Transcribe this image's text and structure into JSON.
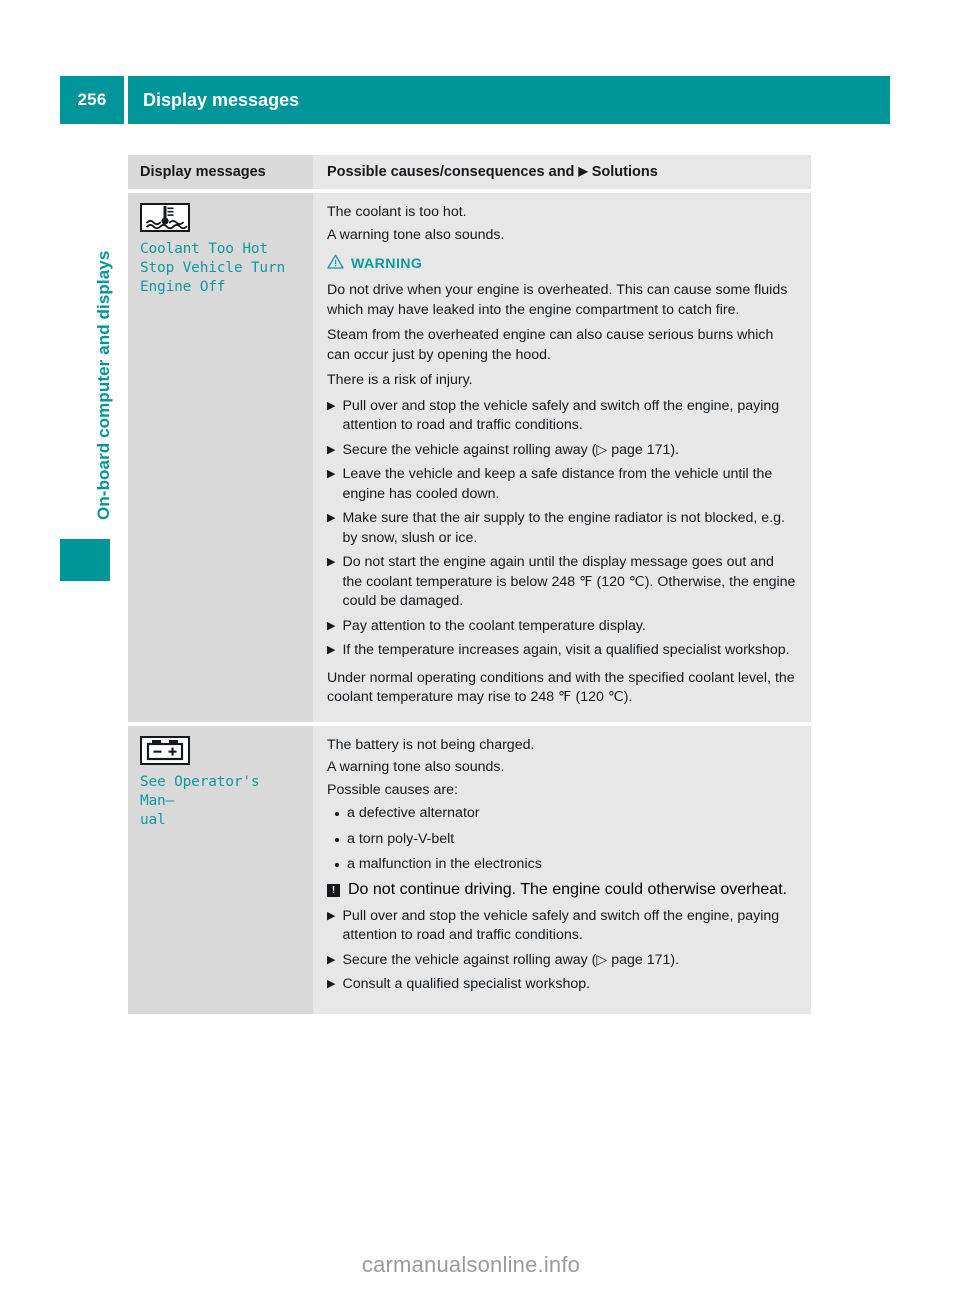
{
  "header": {
    "page_number": "256",
    "title": "Display messages",
    "accent_color": "#009699"
  },
  "sidebar": {
    "chapter_label": "On-board computer and displays",
    "tab_color": "#009699"
  },
  "table": {
    "col1_header": "Display messages",
    "col2_header_pre": "Possible causes/consequences and",
    "col2_header_marker": "▶",
    "col2_header_post": "Solutions",
    "rows": [
      {
        "icon_name": "coolant-temperature-icon",
        "display_text": "Coolant Too Hot\nStop Vehicle Turn\nEngine Off",
        "lead_lines": [
          "The coolant is too hot.",
          "A warning tone also sounds."
        ],
        "warning_label": "WARNING",
        "warning_paragraphs": [
          "Do not drive when your engine is overheated. This can cause some fluids which may have leaked into the engine compartment to catch fire.",
          "Steam from the overheated engine can also cause serious burns which can occur just by opening the hood.",
          "There is a risk of injury."
        ],
        "solutions": [
          "Pull over and stop the vehicle safely and switch off the engine, paying attention to road and traffic conditions.",
          "Secure the vehicle against rolling away (▷ page 171).",
          "Leave the vehicle and keep a safe distance from the vehicle until the engine has cooled down.",
          "Make sure that the air supply to the engine radiator is not blocked, e.g. by snow, slush or ice.",
          "Do not start the engine again until the display message goes out and the coolant temperature is below 248 ℉ (120 ℃). Otherwise, the engine could be damaged.",
          "Pay attention to the coolant temperature display.",
          "If the temperature increases again, visit a qualified specialist workshop."
        ],
        "tail_paragraph": "Under normal operating conditions and with the specified coolant level, the coolant temperature may rise to 248 ℉ (120 ℃)."
      },
      {
        "icon_name": "battery-charge-icon",
        "display_text": "See Operator's Man–\nual",
        "lead_lines": [
          "The battery is not being charged.",
          "A warning tone also sounds.",
          "Possible causes are:"
        ],
        "causes": [
          "a defective alternator",
          "a torn poly-V-belt",
          "a malfunction in the electronics"
        ],
        "note_marker": "!",
        "note_text": "Do not continue driving. The engine could otherwise overheat.",
        "solutions": [
          "Pull over and stop the vehicle safely and switch off the engine, paying attention to road and traffic conditions.",
          "Secure the vehicle against rolling away (▷ page 171).",
          "Consult a qualified specialist workshop."
        ]
      }
    ],
    "bullet_marker": "▶"
  },
  "watermark": "carmanualsonline.info"
}
